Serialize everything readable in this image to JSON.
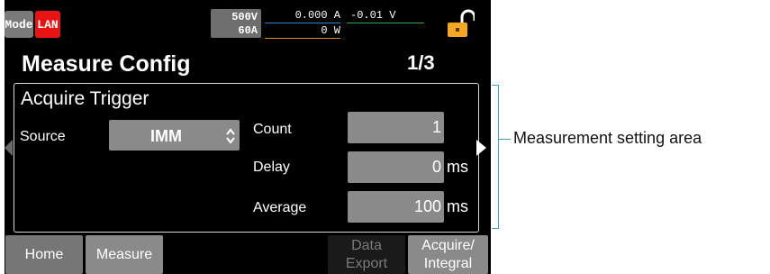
{
  "status_bar": {
    "mode_label": "Mode",
    "interface_label": "LAN",
    "voltage_limit": "500V",
    "current_limit": "60A",
    "measured_current": "0.000 A",
    "measured_voltage": "-0.01 V",
    "measured_power": "0 W",
    "lock_icon": "unlocked-padlock-icon"
  },
  "header": {
    "title": "Measure Config",
    "page_number": "1/3"
  },
  "panel": {
    "section_title": "Acquire Trigger",
    "source": {
      "label": "Source",
      "value": "IMM"
    },
    "count": {
      "label": "Count",
      "value": "1"
    },
    "delay": {
      "label": "Delay",
      "value": "0",
      "unit": "ms"
    },
    "average": {
      "label": "Average",
      "value": "100",
      "unit": "ms"
    }
  },
  "softkeys": {
    "home": "Home",
    "measure": "Measure",
    "data_export_line1": "Data",
    "data_export_line2": "Export",
    "acquire_line1": "Acquire/",
    "acquire_line2": "Integral"
  },
  "annotation": {
    "callout_text": "Measurement setting area"
  },
  "colors": {
    "lan": "#e81414",
    "current_line": "#2f7fd6",
    "voltage_line": "#2fa84a",
    "power_line": "#e08a20",
    "lock": "#f5a623",
    "callout": "#3fa4c2"
  }
}
